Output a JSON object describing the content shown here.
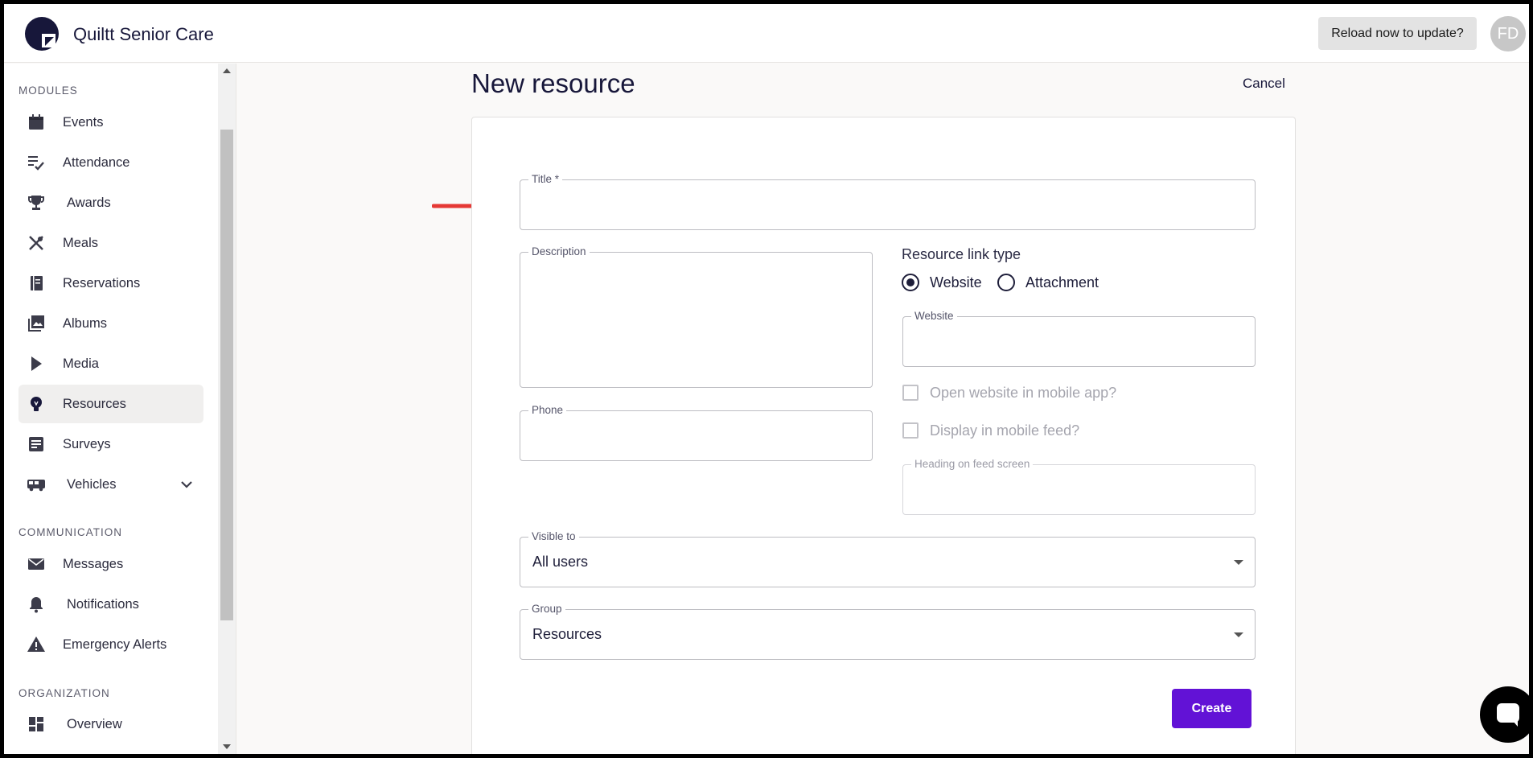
{
  "header": {
    "app_name": "Quiltt Senior Care",
    "reload_label": "Reload now to update?",
    "avatar_initials": "FD"
  },
  "sidebar": {
    "sections": [
      {
        "label": "MODULES"
      },
      {
        "label": "COMMUNICATION"
      },
      {
        "label": "ORGANIZATION"
      }
    ],
    "items": [
      {
        "label": "Events",
        "icon": "calendar-icon"
      },
      {
        "label": "Attendance",
        "icon": "checklist-icon"
      },
      {
        "label": "Awards",
        "icon": "trophy-icon"
      },
      {
        "label": "Meals",
        "icon": "utensils-icon"
      },
      {
        "label": "Reservations",
        "icon": "book-icon"
      },
      {
        "label": "Albums",
        "icon": "photo-library-icon"
      },
      {
        "label": "Media",
        "icon": "play-icon"
      },
      {
        "label": "Resources",
        "icon": "lightbulb-icon",
        "active": true
      },
      {
        "label": "Surveys",
        "icon": "survey-icon"
      },
      {
        "label": "Vehicles",
        "icon": "bus-icon",
        "expandable": true
      },
      {
        "label": "Messages",
        "icon": "mail-icon"
      },
      {
        "label": "Notifications",
        "icon": "bell-icon"
      },
      {
        "label": "Emergency Alerts",
        "icon": "warning-icon"
      },
      {
        "label": "Overview",
        "icon": "dashboard-icon"
      }
    ]
  },
  "main": {
    "title": "New resource",
    "cancel_label": "Cancel",
    "form": {
      "title_label": "Title *",
      "title_value": "",
      "description_label": "Description",
      "description_value": "",
      "phone_label": "Phone",
      "phone_value": "",
      "link_type_heading": "Resource link type",
      "link_type_options": [
        {
          "label": "Website",
          "checked": true
        },
        {
          "label": "Attachment",
          "checked": false
        }
      ],
      "website_label": "Website",
      "website_value": "",
      "open_in_app_label": "Open website in mobile app?",
      "display_in_feed_label": "Display in mobile feed?",
      "feed_heading_label": "Heading on feed screen",
      "visible_to_label": "Visible to",
      "visible_to_value": "All users",
      "group_label": "Group",
      "group_value": "Resources",
      "create_label": "Create"
    }
  },
  "colors": {
    "primary": "#6212d6",
    "navy": "#17173a",
    "annotation_arrow": "#e53935"
  }
}
